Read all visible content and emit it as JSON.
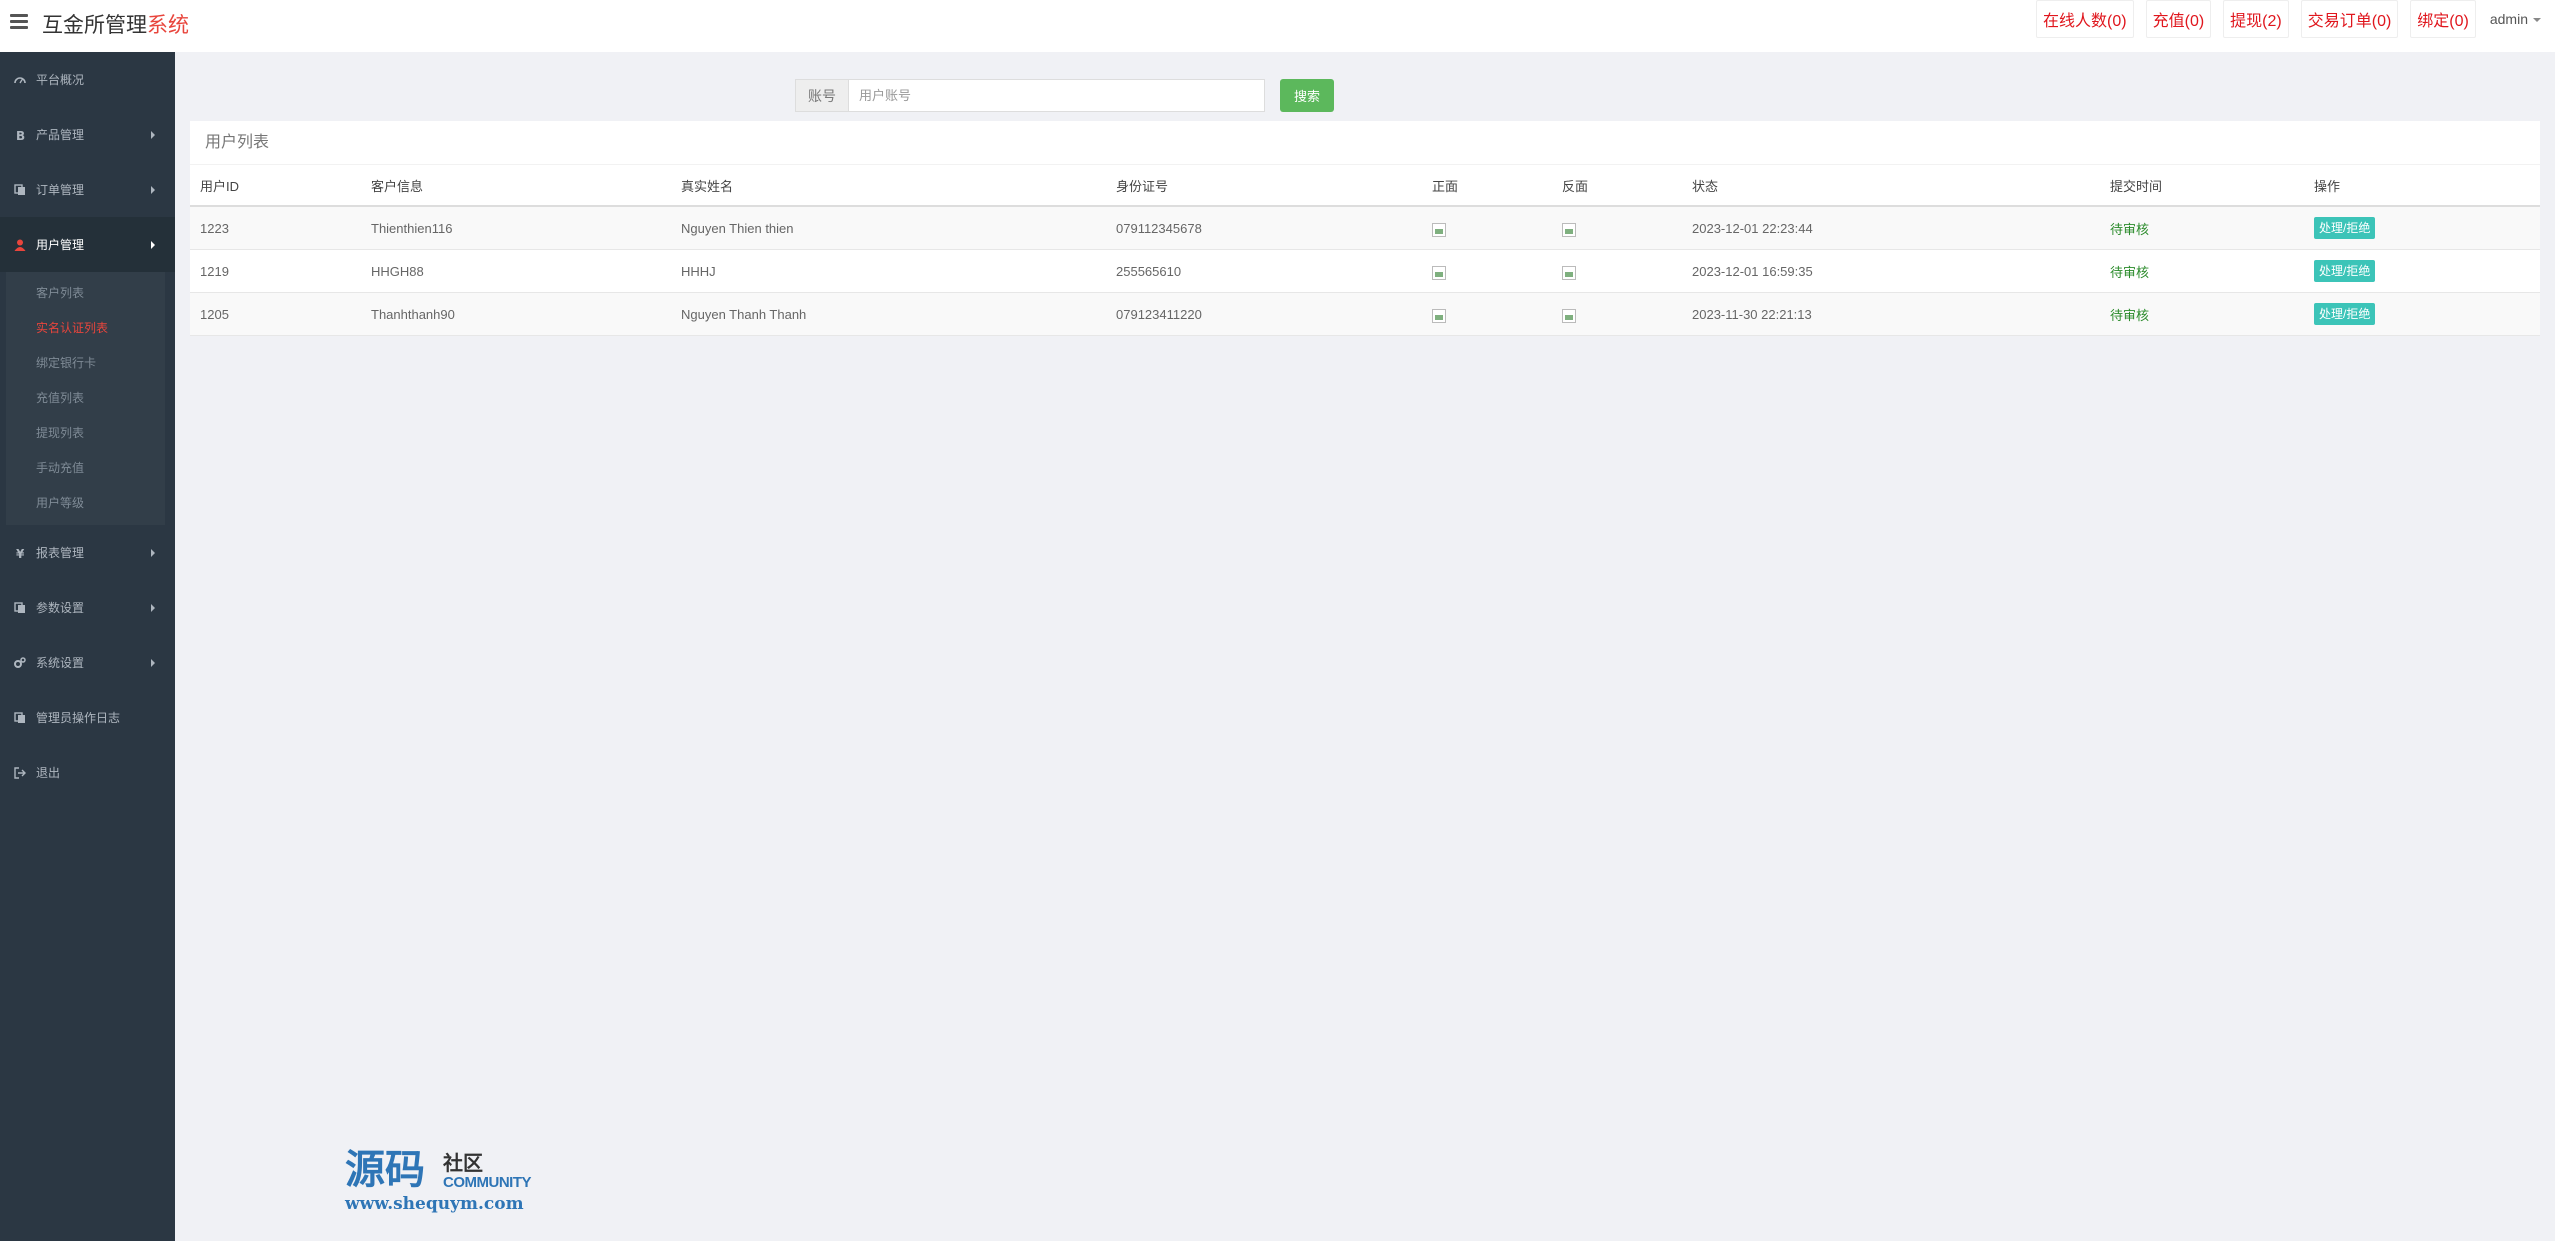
{
  "header": {
    "brand_main": "互金所管理",
    "brand_accent": "系统",
    "nav": [
      {
        "label": "在线人数(0)"
      },
      {
        "label": "充值(0)"
      },
      {
        "label": "提现(2)"
      },
      {
        "label": "交易订单(0)"
      },
      {
        "label": "绑定(0)"
      }
    ],
    "user": "admin"
  },
  "sidebar": {
    "items": [
      {
        "label": "平台概况",
        "icon": "dashboard-icon"
      },
      {
        "label": "产品管理",
        "icon": "bitcoin-icon"
      },
      {
        "label": "订单管理",
        "icon": "copy-icon"
      },
      {
        "label": "用户管理",
        "icon": "user-icon"
      },
      {
        "label": "报表管理",
        "icon": "yen-icon"
      },
      {
        "label": "参数设置",
        "icon": "copy-icon"
      },
      {
        "label": "系统设置",
        "icon": "cogs-icon"
      },
      {
        "label": "管理员操作日志",
        "icon": "copy-icon"
      },
      {
        "label": "退出",
        "icon": "sign-out-icon"
      }
    ],
    "submenu": [
      {
        "label": "客户列表"
      },
      {
        "label": "实名认证列表"
      },
      {
        "label": "绑定银行卡"
      },
      {
        "label": "充值列表"
      },
      {
        "label": "提现列表"
      },
      {
        "label": "手动充值"
      },
      {
        "label": "用户等级"
      }
    ]
  },
  "search": {
    "addon_label": "账号",
    "placeholder": "用户账号",
    "value": "",
    "button_label": "搜索"
  },
  "table": {
    "title": "用户列表",
    "columns": [
      "用户ID",
      "客户信息",
      "真实姓名",
      "身份证号",
      "正面",
      "反面",
      "状态",
      "提交时间",
      "操作"
    ],
    "rows": [
      {
        "id": "1223",
        "account": "Thienthien116",
        "name": "Nguyen Thien thien",
        "id_number": "079112345678",
        "time": "2023-12-01 22:23:44",
        "status": "待审核",
        "action": "处理/拒绝"
      },
      {
        "id": "1219",
        "account": "HHGH88",
        "name": "HHHJ",
        "id_number": "255565610",
        "time": "2023-12-01 16:59:35",
        "status": "待审核",
        "action": "处理/拒绝"
      },
      {
        "id": "1205",
        "account": "Thanhthanh90",
        "name": "Nguyen Thanh Thanh",
        "id_number": "079123411220",
        "time": "2023-11-30 22:21:13",
        "status": "待审核",
        "action": "处理/拒绝"
      }
    ]
  },
  "watermark": {
    "big": "源码",
    "small": "社区",
    "community": "COMMUNITY",
    "url": "www.shequym.com"
  },
  "colors": {
    "sidebar_bg": "#2b3743",
    "accent_red": "#e8453c",
    "search_button": "#5cb85c",
    "action_button": "#3cc4b8",
    "status_pending": "#2a8b2a"
  }
}
